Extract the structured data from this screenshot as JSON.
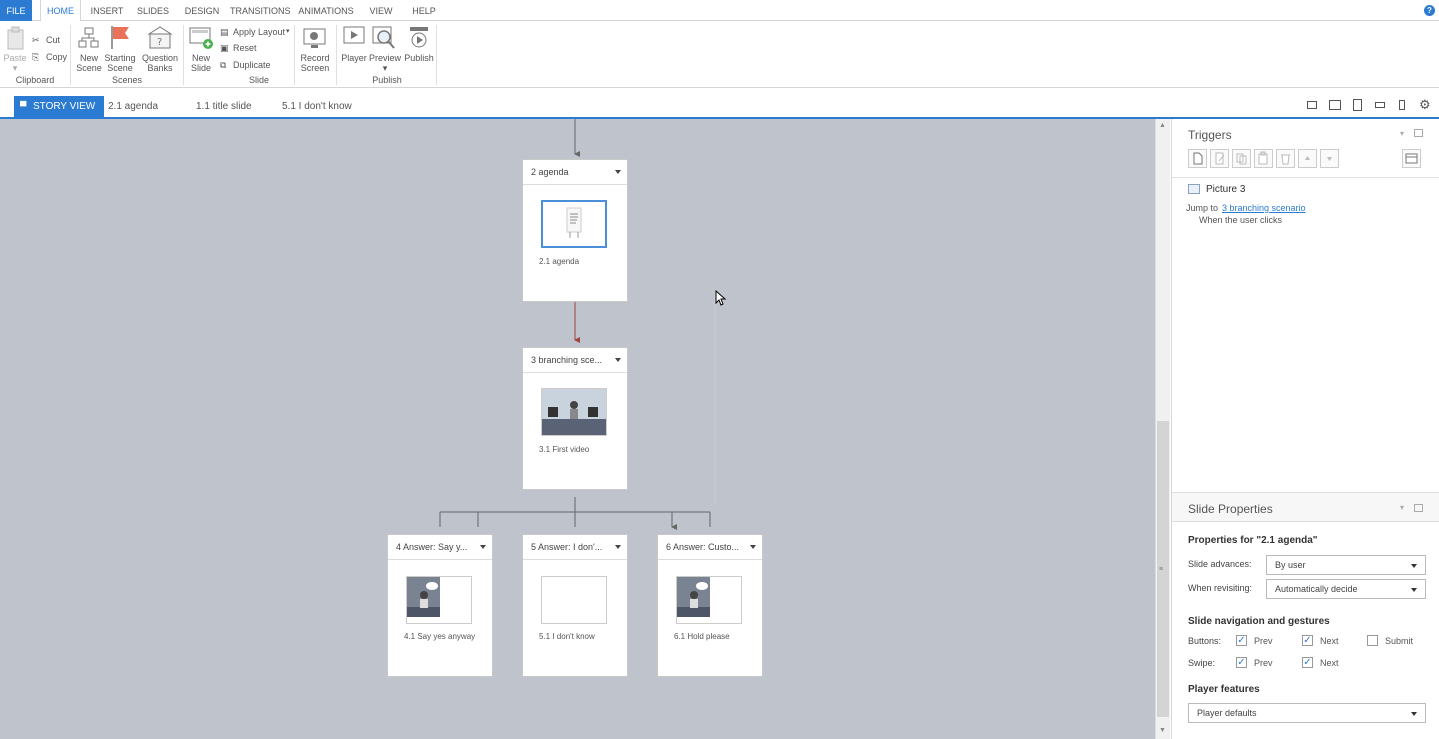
{
  "ribbon_tabs": [
    "FILE",
    "HOME",
    "INSERT",
    "SLIDES",
    "DESIGN",
    "TRANSITIONS",
    "ANIMATIONS",
    "VIEW",
    "HELP"
  ],
  "help_icon": "?",
  "ribbon": {
    "paste": "Paste",
    "cut": "Cut",
    "copy": "Copy",
    "clipboard_group": "Clipboard",
    "new_scene": [
      "New",
      "Scene"
    ],
    "starting_scene": [
      "Starting",
      "Scene"
    ],
    "question_banks": [
      "Question",
      "Banks"
    ],
    "scenes_group": "Scenes",
    "new_slide": [
      "New",
      "Slide"
    ],
    "apply_layout": "Apply Layout",
    "reset": "Reset",
    "duplicate": "Duplicate",
    "slide_group": "Slide",
    "record_screen": [
      "Record",
      "Screen"
    ],
    "player": "Player",
    "preview": "Preview",
    "publish": "Publish",
    "publish_group": "Publish"
  },
  "storybar": {
    "tabs": [
      "STORY VIEW",
      "2.1 agenda",
      "1.1 title slide",
      "5.1 I don't know"
    ]
  },
  "scenes": [
    {
      "title": "2 agenda",
      "slide": "2.1 agenda"
    },
    {
      "title": "3 branching sce...",
      "slide": "3.1 First video"
    },
    {
      "title": "4 Answer: Say y...",
      "slide": "4.1 Say yes anyway"
    },
    {
      "title": "5 Answer: I don'...",
      "slide": "5.1 I don't know"
    },
    {
      "title": "6 Answer: Custo...",
      "slide": "6.1 Hold please"
    }
  ],
  "triggers": {
    "title": "Triggers",
    "object": "Picture 3",
    "action_prefix": "Jump to",
    "action_link": "3 branching scenario",
    "condition": "When the user clicks"
  },
  "slide_properties": {
    "title": "Slide Properties",
    "heading": "Properties for \"2.1 agenda\"",
    "slide_advances_label": "Slide advances:",
    "slide_advances_value": "By user",
    "when_revisiting_label": "When revisiting:",
    "when_revisiting_value": "Automatically decide",
    "nav_heading": "Slide navigation and gestures",
    "buttons_label": "Buttons:",
    "swipe_label": "Swipe:",
    "prev": "Prev",
    "next": "Next",
    "submit": "Submit",
    "player_features_heading": "Player features",
    "player_features_value": "Player defaults"
  },
  "colors": {
    "accent": "#2b7bd3",
    "canvas": "#bfc3cc",
    "arrow_red": "#a0463c"
  }
}
